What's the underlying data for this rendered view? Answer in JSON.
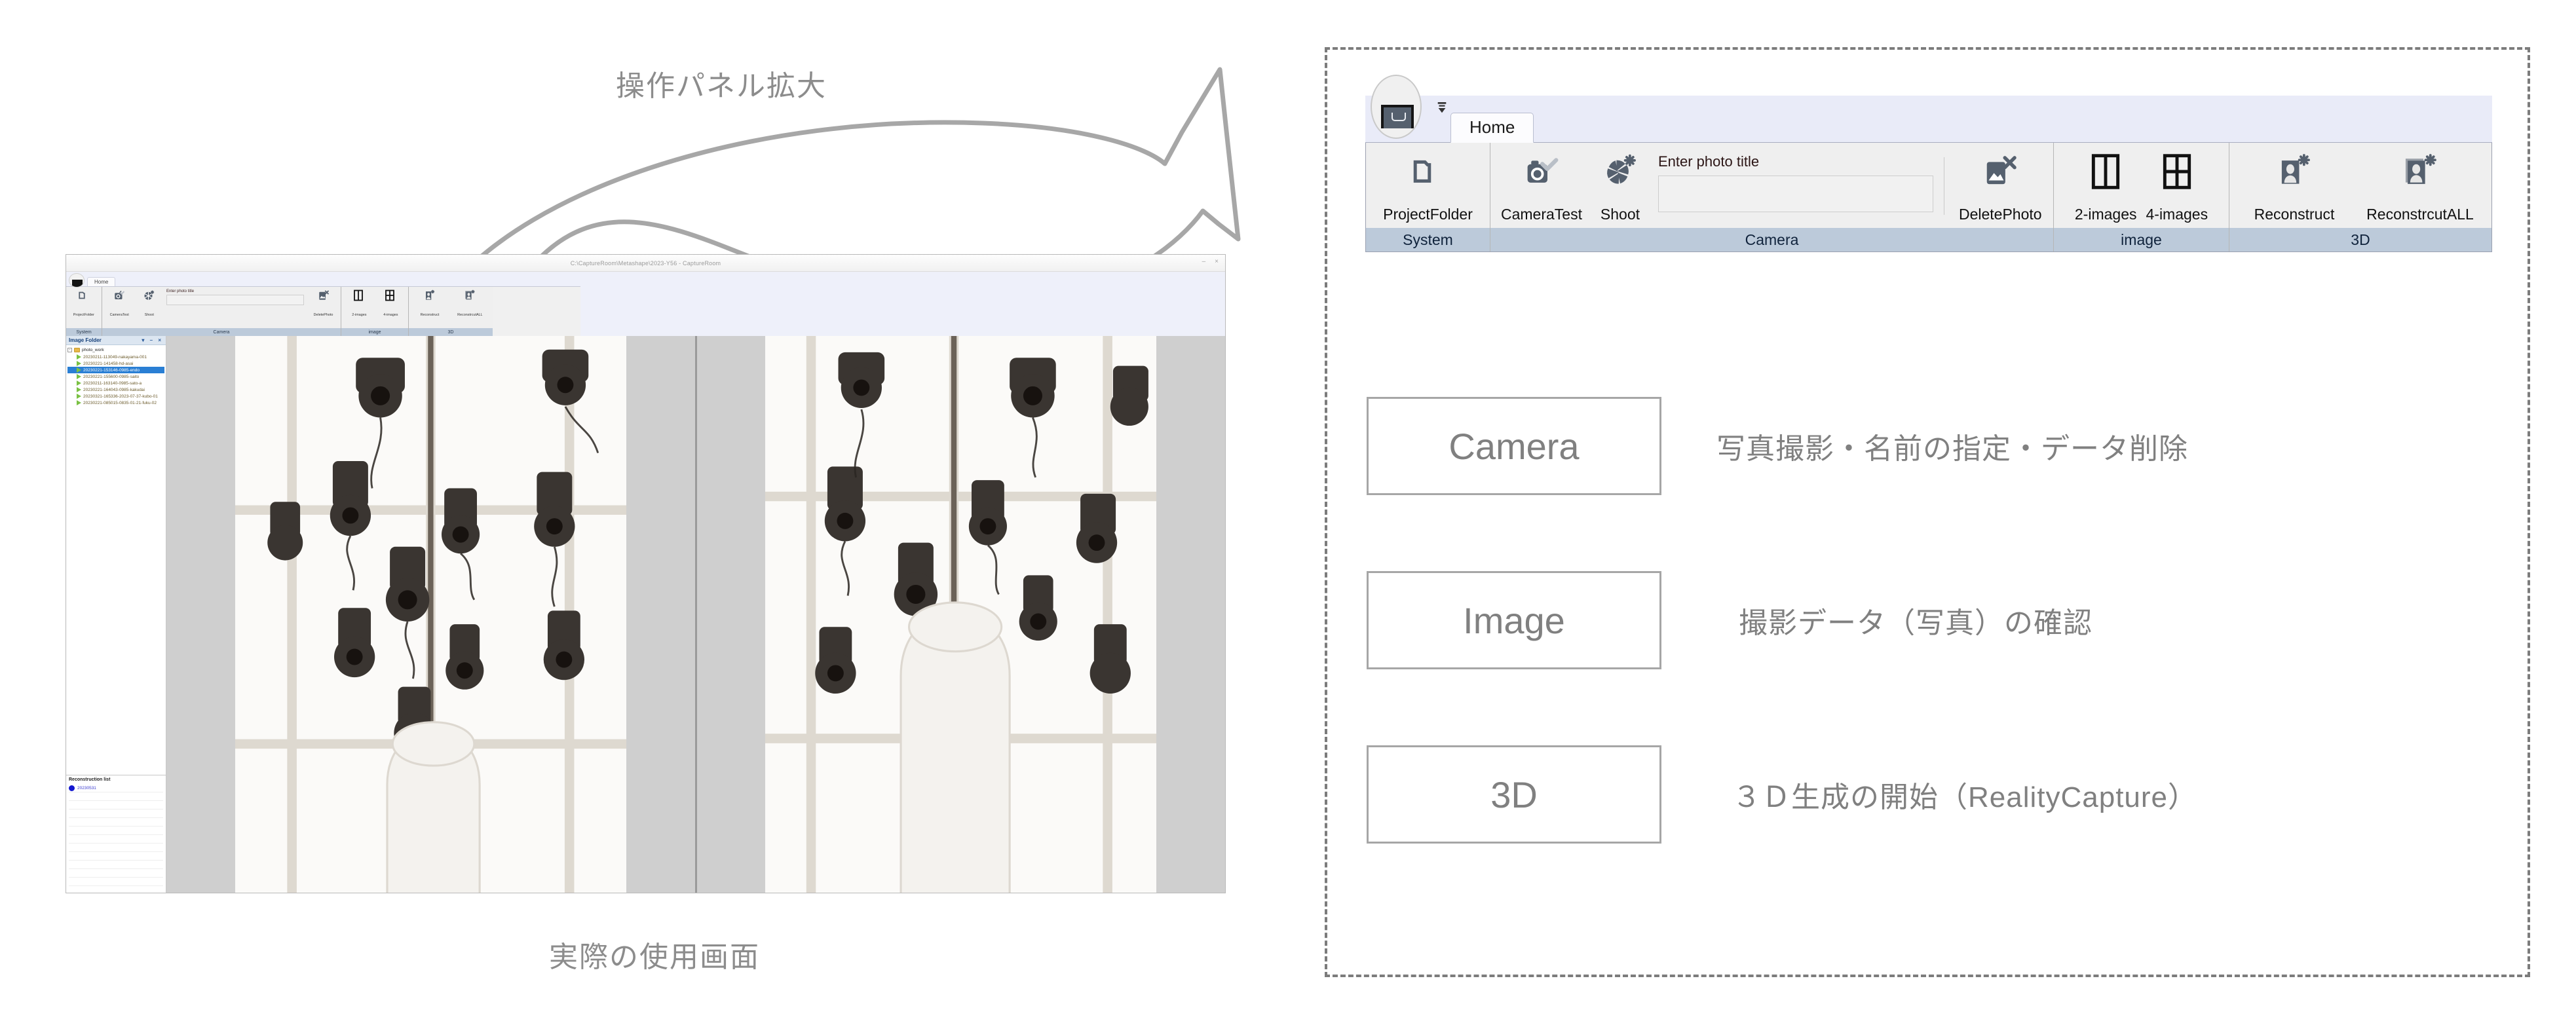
{
  "captions": {
    "top": "操作パネル拡大",
    "bottom": "実際の使用画面"
  },
  "app_window": {
    "title": "C:\\CaptureRoom\\Metashape\\2023-Y56 - CaptureRoom",
    "minimize_label": "–",
    "close_label": "×",
    "tab_home": "Home",
    "groups": [
      {
        "name": "System",
        "items": [
          {
            "label": "ProjectFolder",
            "icon": "folder-icon"
          }
        ]
      },
      {
        "name": "Camera",
        "items": [
          {
            "label": "CameraTest",
            "icon": "camera-check-icon"
          },
          {
            "label": "Shoot",
            "icon": "shutter-flash-icon"
          },
          {
            "label": "DeletePhoto",
            "icon": "photo-delete-icon"
          }
        ]
      },
      {
        "name": "image",
        "items": [
          {
            "label": "2-images",
            "icon": "two-pane-icon"
          },
          {
            "label": "4-images",
            "icon": "four-pane-icon"
          }
        ]
      },
      {
        "name": "3D",
        "items": [
          {
            "label": "Reconstruct",
            "icon": "person-flash-icon"
          },
          {
            "label": "ReconstrcutALL",
            "icon": "person-flash-stack-icon"
          }
        ]
      }
    ],
    "photo_title_caption": "Enter photo title",
    "photo_title_value": "",
    "explorer": {
      "header": "Image Folder",
      "header_buttons": "▾ – ×",
      "root": "photo_work",
      "items": [
        {
          "label": "20230211-113049-nakayama-001",
          "selected": false
        },
        {
          "label": "20230221-141458-hd-asai",
          "selected": false
        },
        {
          "label": "20230221-153146-0985-endo",
          "selected": true
        },
        {
          "label": "20230221-155600-0985-saito",
          "selected": false
        },
        {
          "label": "20230211-163140-0985-sato-a",
          "selected": false
        },
        {
          "label": "20230221-164043-0985-kakudai",
          "selected": false
        },
        {
          "label": "20230321-165336-2023-07-37-kubo-01",
          "selected": false
        },
        {
          "label": "20230221-085015-0835-01-21-fuku-02",
          "selected": false
        }
      ]
    },
    "reconstruction": {
      "header": "Reconstruction list",
      "rows": [
        {
          "label": "20230531"
        }
      ]
    }
  },
  "ribbon": {
    "tab_home": "Home",
    "app_button_name": "file-menu",
    "groups": [
      {
        "name": "System",
        "items": [
          {
            "label": "ProjectFolder",
            "icon": "folder-icon"
          }
        ]
      },
      {
        "name": "Camera",
        "items": [
          {
            "label": "CameraTest",
            "icon": "camera-check-icon"
          },
          {
            "label": "Shoot",
            "icon": "shutter-flash-icon"
          },
          {
            "label": "DeletePhoto",
            "icon": "photo-delete-icon"
          }
        ],
        "photo_title_caption": "Enter photo title",
        "photo_title_value": "",
        "photo_title_placeholder": ""
      },
      {
        "name": "image",
        "items": [
          {
            "label": "2-images",
            "icon": "two-pane-icon"
          },
          {
            "label": "4-images",
            "icon": "four-pane-icon"
          }
        ]
      },
      {
        "name": "3D",
        "items": [
          {
            "label": "Reconstruct",
            "icon": "person-flash-icon"
          },
          {
            "label": "ReconstrcutALL",
            "icon": "person-flash-stack-icon"
          }
        ]
      }
    ]
  },
  "legend": [
    {
      "box": "Camera",
      "text": "写真撮影・名前の指定・データ削除"
    },
    {
      "box": "Image",
      "text": "撮影データ（写真）の確認"
    },
    {
      "box": "3D",
      "text": "３Ｄ生成の開始（RealityCapture）"
    }
  ],
  "colors": {
    "group_footer": "#bccada",
    "tab_strip": "#e9ebf8",
    "icon_dark": "#55606e",
    "caption_gray": "#8c8c8c",
    "dashed_border": "#7c7c7c",
    "tree_selection": "#2a7fd4"
  }
}
